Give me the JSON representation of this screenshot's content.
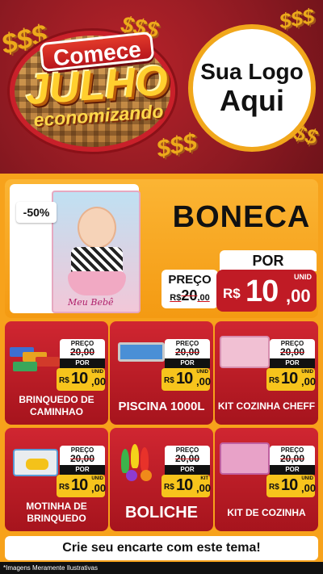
{
  "header": {
    "brand_line1": "Comece",
    "brand_line2": "JULHO",
    "brand_line3": "economizando",
    "dollar_signs": [
      "$$$",
      "$$$",
      "$$$",
      "$$$",
      "$$$"
    ],
    "logo_line1": "Sua Logo",
    "logo_line2": "Aqui"
  },
  "featured": {
    "discount": "-50%",
    "title": "BONECA",
    "box_label": "Meu Bebê",
    "preco_label": "PREÇO",
    "old_currency": "R$",
    "old_int": "20",
    "old_cents": ",00",
    "por_label": "POR",
    "unid": "UNID",
    "currency": "R$",
    "price_int": "10",
    "price_cents": ",00"
  },
  "products": [
    {
      "name": "BRINQUEDO DE CAMINHAO",
      "preco_label": "PREÇO",
      "old_int": "20",
      "old_cents": ",00",
      "por_label": "POR",
      "unit": "UNID",
      "currency": "R$",
      "price_int": "10",
      "price_cents": ",00"
    },
    {
      "name": "PISCINA 1000L",
      "preco_label": "PREÇO",
      "old_int": "20",
      "old_cents": ",00",
      "por_label": "POR",
      "unit": "UNID",
      "currency": "R$",
      "price_int": "10",
      "price_cents": ",00"
    },
    {
      "name": "KIT COZINHA CHEFF",
      "preco_label": "PREÇO",
      "old_int": "20",
      "old_cents": ",00",
      "por_label": "POR",
      "unit": "UNID",
      "currency": "R$",
      "price_int": "10",
      "price_cents": ",00"
    },
    {
      "name": "MOTINHA DE BRINQUEDO",
      "preco_label": "PREÇO",
      "old_int": "20",
      "old_cents": ",00",
      "por_label": "POR",
      "unit": "UNID",
      "currency": "R$",
      "price_int": "10",
      "price_cents": ",00"
    },
    {
      "name": "BOLICHE",
      "preco_label": "PREÇO",
      "old_int": "20",
      "old_cents": ",00",
      "por_label": "POR",
      "unit": "KIT",
      "currency": "R$",
      "price_int": "10",
      "price_cents": ",00"
    },
    {
      "name": "KIT DE COZINHA",
      "preco_label": "PREÇO",
      "old_int": "20",
      "old_cents": ",00",
      "por_label": "POR",
      "unit": "UNID",
      "currency": "R$",
      "price_int": "10",
      "price_cents": ",00"
    }
  ],
  "footer": {
    "cta": "Crie seu encarte com este tema!",
    "disclaimer": "*Imagens Meramente Ilustrativas"
  },
  "colors": {
    "header_red": "#8e1a22",
    "orange": "#f7a21b",
    "card_red": "#c01b25",
    "price_yellow": "#f7c41c"
  }
}
